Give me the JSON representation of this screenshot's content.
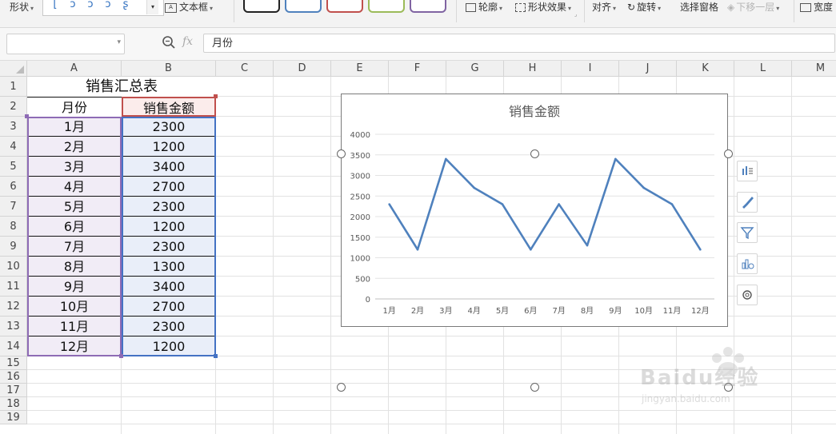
{
  "toolbar": {
    "shape_label": "形状",
    "textbox_label": "文本框",
    "outline_label": "轮廓",
    "shape_effects_label": "形状效果",
    "align_label": "对齐",
    "rotate_label": "旋转",
    "selection_pane_label": "选择窗格",
    "send_backward_label": "下移一层",
    "width_label": "宽度",
    "style_swatch_colors": [
      "#222222",
      "#4f81bd",
      "#c0504d",
      "#9bbb59",
      "#8064a2"
    ]
  },
  "formula_bar": {
    "fx_label": "fx",
    "value": "月份"
  },
  "columns": [
    "A",
    "B",
    "C",
    "D",
    "E",
    "F",
    "G",
    "H",
    "I",
    "J",
    "K",
    "L",
    "M"
  ],
  "rows": [
    "1",
    "2",
    "3",
    "4",
    "5",
    "6",
    "7",
    "8",
    "9",
    "10",
    "11",
    "12",
    "13",
    "14",
    "15",
    "16",
    "17",
    "18",
    "19"
  ],
  "sheet": {
    "title": "销售汇总表",
    "header": [
      "月份",
      "销售金额"
    ],
    "data": [
      [
        "1月",
        "2300"
      ],
      [
        "2月",
        "1200"
      ],
      [
        "3月",
        "3400"
      ],
      [
        "4月",
        "2700"
      ],
      [
        "5月",
        "2300"
      ],
      [
        "6月",
        "1200"
      ],
      [
        "7月",
        "2300"
      ],
      [
        "8月",
        "1300"
      ],
      [
        "9月",
        "3400"
      ],
      [
        "10月",
        "2700"
      ],
      [
        "11月",
        "2300"
      ],
      [
        "12月",
        "1200"
      ]
    ]
  },
  "chart_data": {
    "type": "line",
    "title": "销售金额",
    "categories": [
      "1月",
      "2月",
      "3月",
      "4月",
      "5月",
      "6月",
      "7月",
      "8月",
      "9月",
      "10月",
      "11月",
      "12月"
    ],
    "series": [
      {
        "values": [
          2300,
          1200,
          3400,
          2700,
          2300,
          1200,
          2300,
          1300,
          3400,
          2700,
          2300,
          1200
        ],
        "color": "#4f81bd"
      }
    ],
    "ylim": [
      0,
      4000
    ],
    "yticks": [
      "0",
      "500",
      "1000",
      "1500",
      "2000",
      "2500",
      "3000",
      "3500",
      "4000"
    ],
    "grid": true,
    "xlabel": "",
    "ylabel": ""
  },
  "chart_side_buttons": [
    "chart-elements-icon",
    "chart-style-icon",
    "chart-filter-icon",
    "chart-type-icon",
    "chart-settings-icon"
  ],
  "watermark": {
    "brand": "Baidu经验",
    "url": "jingyan.baidu.com"
  }
}
